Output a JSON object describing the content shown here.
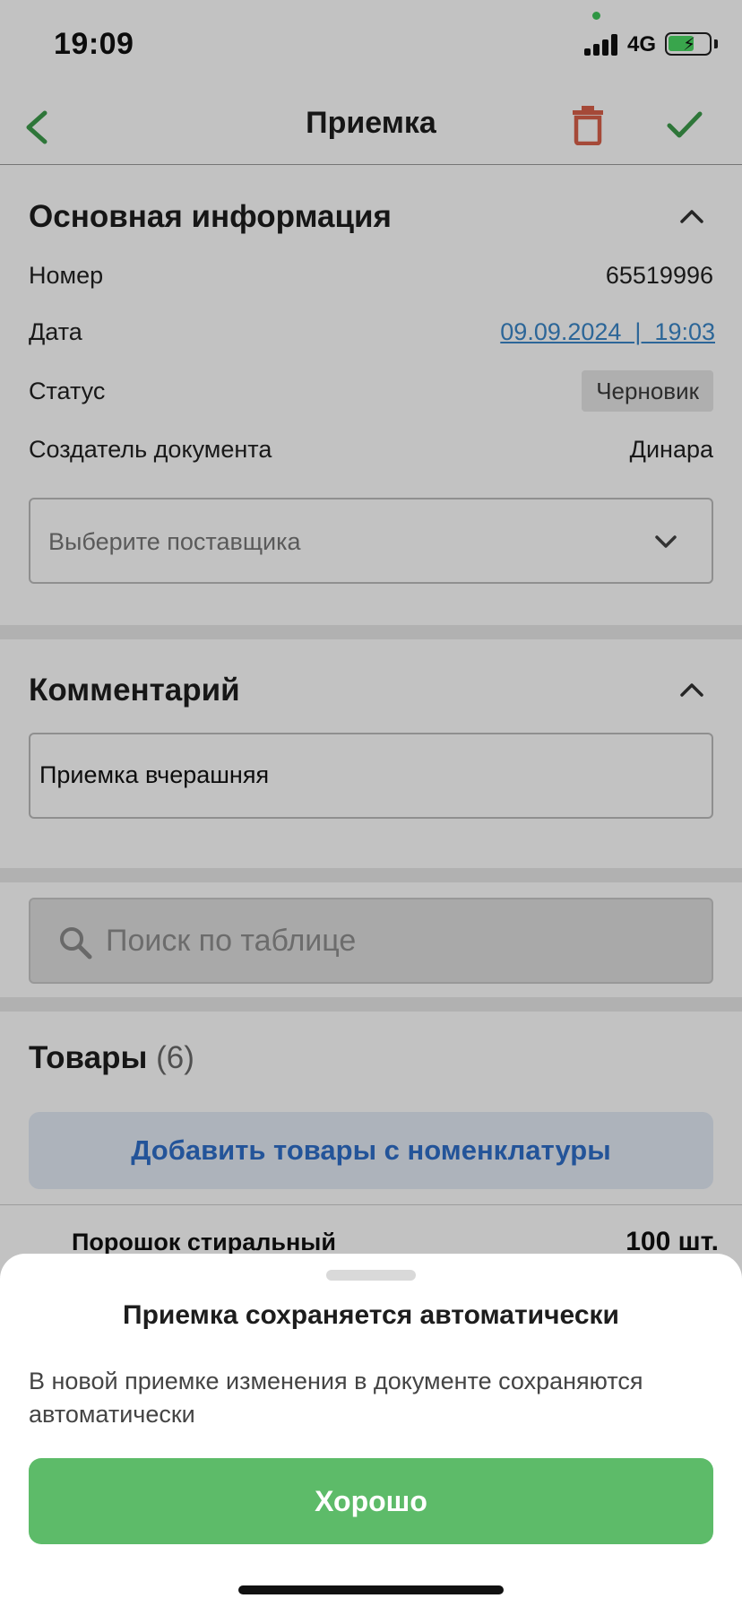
{
  "status_bar": {
    "time": "19:09",
    "network": "4G"
  },
  "navbar": {
    "title": "Приемка"
  },
  "main_info": {
    "title": "Основная информация",
    "rows": {
      "number": {
        "label": "Номер",
        "value": "65519996"
      },
      "date": {
        "label": "Дата",
        "value": "09.09.2024  |  19:03"
      },
      "status": {
        "label": "Статус",
        "value": "Черновик"
      },
      "creator": {
        "label": "Создатель документа",
        "value": "Динара"
      }
    },
    "supplier_placeholder": "Выберите поставщика"
  },
  "comment": {
    "title": "Комментарий",
    "value": "Приемка вчерашняя"
  },
  "search": {
    "placeholder": "Поиск по таблице"
  },
  "goods": {
    "title": "Товары",
    "count": "(6)",
    "add_button": "Добавить товары с номенклатуры",
    "items": [
      {
        "name": "Порошок стиральный",
        "qty": "100 шт."
      }
    ]
  },
  "sheet": {
    "title": "Приемка сохраняется автоматически",
    "text": "В новой приемке изменения в документе сохраняются автоматически",
    "ok_button": "Хорошо"
  },
  "colors": {
    "accent_green": "#5dbb69",
    "danger": "#d9614a",
    "link_blue": "#3b86c8",
    "button_blue_text": "#2f6fc9"
  },
  "icons": [
    "back-arrow-icon",
    "trash-icon",
    "checkmark-icon",
    "chevron-up-icon",
    "chevron-down-icon",
    "search-icon"
  ]
}
